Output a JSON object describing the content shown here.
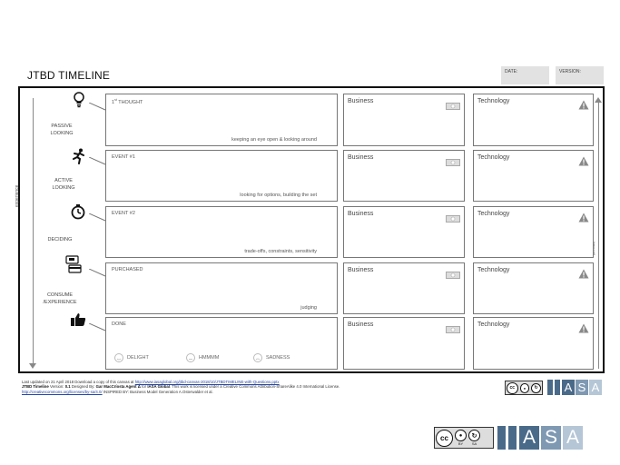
{
  "header": {
    "title": "JTBD TIMELINE",
    "date_label": "DATE:",
    "version_label": "VERSION:"
  },
  "axes": {
    "left_label": "experience",
    "right_label": "impact"
  },
  "stages": [
    {
      "label_line1": "PASSIVE",
      "label_line2": "LOOKING",
      "icon": "lightbulb-icon"
    },
    {
      "label_line1": "ACTIVE",
      "label_line2": "LOOKING",
      "icon": "running-person-icon"
    },
    {
      "label_line1": "DECIDING",
      "label_line2": "",
      "icon": "stopwatch-icon"
    },
    {
      "label_line1": "CONSUME",
      "label_line2": "/EXPERIENCE",
      "icon": "wallet-card-icon"
    },
    {
      "label_line1": "",
      "label_line2": "",
      "icon": "thumbs-up-icon"
    }
  ],
  "cards": [
    {
      "title_pre": "1",
      "title_sup": "st",
      "title_post": " THOUGHT",
      "caption": "keeping an eye open & looking around"
    },
    {
      "title_pre": "EVENT #1",
      "title_sup": "",
      "title_post": "",
      "caption": "looking for options, building the set"
    },
    {
      "title_pre": "EVENT #2",
      "title_sup": "",
      "title_post": "",
      "caption": "trade-offs, constraints, sensitivity"
    },
    {
      "title_pre": "PURCHASED",
      "title_sup": "",
      "title_post": "",
      "caption": "judging"
    },
    {
      "title_pre": "DONE",
      "title_sup": "",
      "title_post": "",
      "caption": ""
    }
  ],
  "emotions": [
    {
      "label": "DELIGHT",
      "icon": "smile-face-icon"
    },
    {
      "label": "HMMMM",
      "icon": "neutral-face-icon"
    },
    {
      "label": "SADNESS",
      "icon": "sad-face-icon"
    }
  ],
  "business_label": "Business",
  "technology_label": "Technology",
  "business_icon": "money-icon",
  "technology_icon": "warning-icon",
  "footer": {
    "line1_pre": "Last updated on 21 April 2018 Download a copy of this canvas at ",
    "line1_link": "http://www.iasaglobal.org/jtbd-canvas-2018/10/JTBDTIMELINE-with-Questions.pptx",
    "line2_title": "JTBD Timeline",
    "line2_version_pre": " Version: ",
    "line2_version": "0.1",
    "line2_designed_pre": " Designed By: ",
    "line2_designer": "Gar MacCríosta Agent Δ",
    "line2_for": " for ",
    "line2_org": "IASA Global",
    "line2_license": ". This work is licensed under a Creative Commons Attribution-ShareAlike 4.0 International License.",
    "line3_link": "http://creativecommons.org/licenses/by-sa/4.0/",
    "line3_inspired": " INSPIRED BY: Business Model Generation A.Osterwalder et al."
  },
  "logos": {
    "cc_small": "cc",
    "cc_by": "BY",
    "cc_sa": "SA",
    "iasa_letters": [
      "A",
      "S",
      "A"
    ]
  },
  "colors": {
    "frame": "#111111",
    "box_border": "#777777",
    "iasa_blue": "#4a6a8a",
    "meta_bg": "#e2e2e2"
  }
}
